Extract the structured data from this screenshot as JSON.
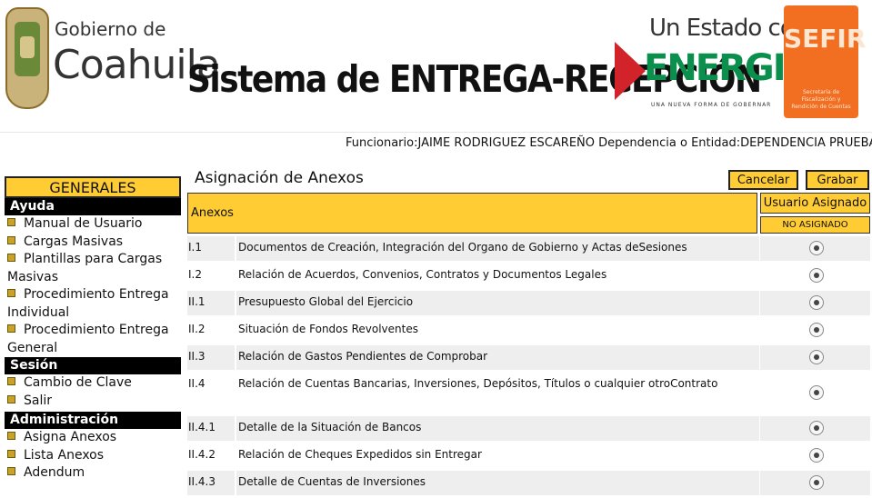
{
  "header": {
    "gobierno_small": "Gobierno de",
    "gobierno_big": "Coahuila",
    "system_title": "Sistema de ENTREGA-RECEPCIÓN",
    "energia_top": "Un Estado con",
    "energia_main": "ENERGIA",
    "energia_sub": "UNA NUEVA FORMA DE GOBERNAR",
    "sefir_title": "SEFIR",
    "sefir_sub": "Secretaría de Fiscalización y Rendición de Cuentas"
  },
  "user_bar": {
    "funcionario_label": "Funcionario:",
    "funcionario_value": "JAIME RODRIGUEZ ESCAREÑO",
    "dependencia_label": " Dependencia o Entidad:",
    "dependencia_value": "DEPENDENCIA PRUEBA"
  },
  "sidebar": {
    "header": "GENERALES",
    "sections": [
      {
        "title": "Ayuda",
        "items": [
          "Manual de Usuario",
          "Cargas Masivas",
          "Plantillas para Cargas Masivas",
          "Procedimiento Entrega Individual",
          "Procedimiento Entrega General"
        ]
      },
      {
        "title": "Sesión",
        "items": [
          "Cambio de Clave",
          "Salir"
        ]
      },
      {
        "title": "Administración",
        "items": [
          "Asigna Anexos",
          "Lista Anexos",
          "Adendum"
        ]
      }
    ]
  },
  "main": {
    "title": "Asignación de Anexos",
    "cancel_label": "Cancelar",
    "save_label": "Grabar",
    "col_anexos": "Anexos",
    "col_usuario": "Usuario Asignado",
    "col_no_asignado": "NO ASIGNADO",
    "rows": [
      {
        "code": "I.1",
        "desc": "Documentos de Creación, Integración del Organo de Gobierno y Actas deSesiones"
      },
      {
        "code": "I.2",
        "desc": "Relación de Acuerdos, Convenios, Contratos y Documentos Legales"
      },
      {
        "code": "II.1",
        "desc": "Presupuesto Global del Ejercicio"
      },
      {
        "code": "II.2",
        "desc": "Situación de Fondos Revolventes"
      },
      {
        "code": "II.3",
        "desc": "Relación de Gastos Pendientes de Comprobar"
      },
      {
        "code": "II.4",
        "desc": "Relación de Cuentas Bancarias, Inversiones, Depósitos, Títulos o cualquier otroContrato"
      },
      {
        "code": "II.4.1",
        "desc": "Detalle de la Situación de Bancos"
      },
      {
        "code": "II.4.2",
        "desc": "Relación de Cheques Expedidos sin Entregar"
      },
      {
        "code": "II.4.3",
        "desc": "Detalle de Cuentas de Inversiones"
      }
    ]
  },
  "colors": {
    "accent": "#ffcc33",
    "section_bg": "#000000",
    "row_alt": "#eeeeee"
  }
}
